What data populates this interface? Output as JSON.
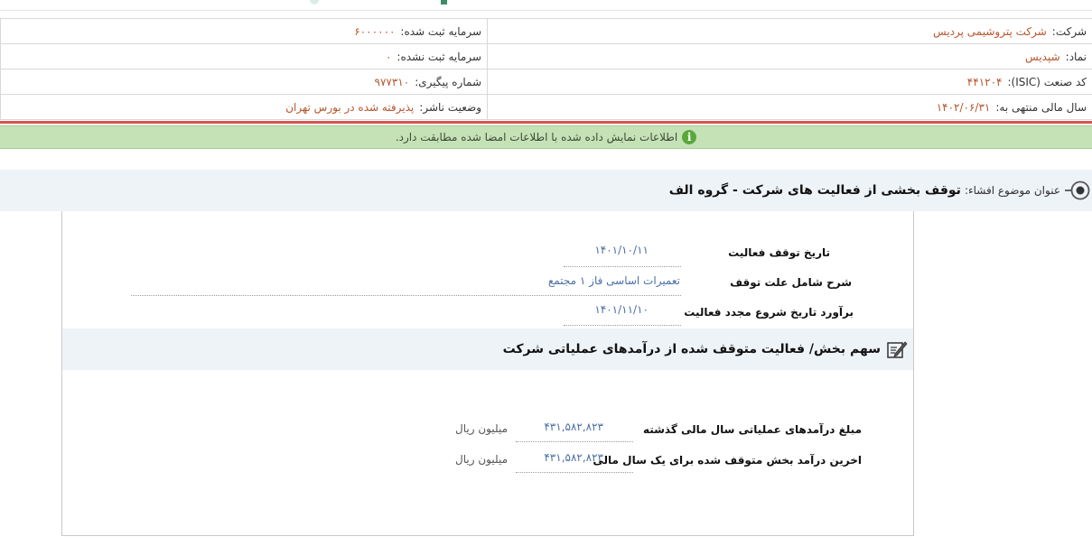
{
  "company_info": {
    "company": {
      "label": "شرکت:",
      "value": "شرکت پتروشیمی پردیس"
    },
    "symbol": {
      "label": "نماد:",
      "value": "شپدیس"
    },
    "isic": {
      "label": "کد صنعت (ISIC):",
      "value": "۴۴۱۲۰۴"
    },
    "fiscal_year": {
      "label": "سال مالی منتهی به:",
      "value": "۱۴۰۲/۰۶/۳۱"
    },
    "registered_capital": {
      "label": "سرمایه ثبت شده:",
      "value": "۶۰۰۰۰۰۰"
    },
    "unregistered_capital": {
      "label": "سرمایه ثبت نشده:",
      "value": "۰"
    },
    "tracking_number": {
      "label": "شماره پیگیری:",
      "value": "۹۷۷۳۱۰"
    },
    "publisher_status": {
      "label": "وضعیت ناشر:",
      "value": "پذیرفته شده در بورس تهران"
    }
  },
  "alert": {
    "text": "اطلاعات نمایش داده شده با اطلاعات امضا شده مطابقت دارد.",
    "icon": "info-icon"
  },
  "subject": {
    "label": "عنوان موضوع افشاء:",
    "title": "توقف بخشی از فعالیت های شرکت - گروه الف"
  },
  "fields": {
    "stop_date": {
      "label": "تاریخ توقف فعالیت",
      "value": "۱۴۰۱/۱۰/۱۱"
    },
    "stop_reason": {
      "label": "شرح شامل علت توقف",
      "value": "تعمیرات اساسی فاز ۱ مجتمع"
    },
    "restart_estimate": {
      "label": "برآورد تاریخ شروع مجدد فعالیت",
      "value": "۱۴۰۱/۱۱/۱۰"
    }
  },
  "share_section": {
    "title": "سهم بخش/ فعالیت متوقف شده از درآمدهای عملیاتی شرکت",
    "last_year_revenue": {
      "label": "مبلغ درآمدهای عملیاتی سال مالی گذشته",
      "value": "۴۳۱,۵۸۲,۸۲۳",
      "unit": "میلیون ریال"
    },
    "stopped_segment_revenue": {
      "label": "اخرین درآمد بخش متوقف شده برای یک سال مالی",
      "value": "۴۳۱,۵۸۲,۸۲۳",
      "unit": "میلیون ریال"
    }
  },
  "colors": {
    "value_text": "#b5562d",
    "alert_bg": "#c5e2b6",
    "red_line": "#d9534f",
    "section_bg": "#eef3f8",
    "field_value": "#4a6fa5"
  }
}
